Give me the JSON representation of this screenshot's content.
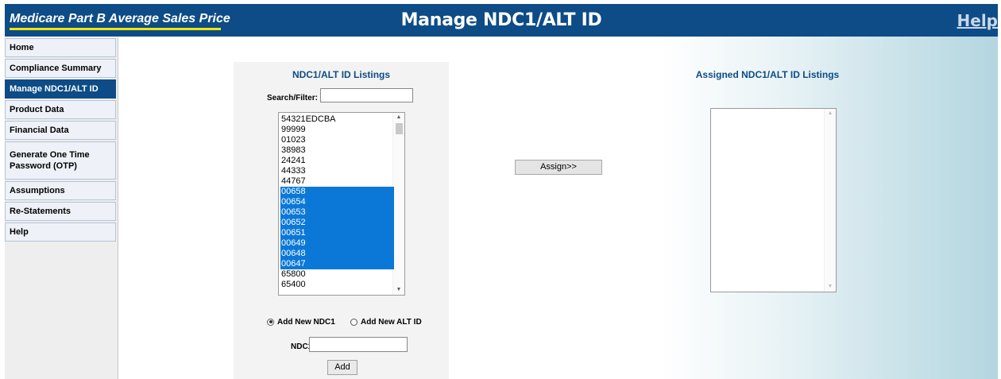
{
  "header": {
    "brand": "Medicare Part B Average Sales Price",
    "title": "Manage NDC1/ALT ID",
    "help_link": "Help",
    "color_header_bg": "#0d4c86",
    "color_brand_underline": "#f2e600"
  },
  "sidebar": {
    "items": [
      {
        "label": "Home",
        "active": false
      },
      {
        "label": "Compliance Summary",
        "active": false
      },
      {
        "label": "Manage NDC1/ALT ID",
        "active": true
      },
      {
        "label": "Product Data",
        "active": false
      },
      {
        "label": "Financial Data",
        "active": false
      },
      {
        "label": "Generate One Time Password (OTP)",
        "active": false
      },
      {
        "label": "Assumptions",
        "active": false
      },
      {
        "label": "Re-Statements",
        "active": false
      },
      {
        "label": "Help",
        "active": false
      }
    ]
  },
  "listings": {
    "title": "NDC1/ALT ID Listings",
    "search_label": "Search/Filter:",
    "search_value": "",
    "items": [
      {
        "label": "54321EDCBA",
        "selected": false
      },
      {
        "label": "99999",
        "selected": false
      },
      {
        "label": "01023",
        "selected": false
      },
      {
        "label": "38983",
        "selected": false
      },
      {
        "label": "24241",
        "selected": false
      },
      {
        "label": "44333",
        "selected": false
      },
      {
        "label": "44767",
        "selected": false
      },
      {
        "label": "00658",
        "selected": true
      },
      {
        "label": "00654",
        "selected": true
      },
      {
        "label": "00653",
        "selected": true
      },
      {
        "label": "00652",
        "selected": true
      },
      {
        "label": "00651",
        "selected": true
      },
      {
        "label": "00649",
        "selected": true
      },
      {
        "label": "00648",
        "selected": true
      },
      {
        "label": "00647",
        "selected": true
      },
      {
        "label": "65800",
        "selected": false
      },
      {
        "label": "65400",
        "selected": false
      }
    ],
    "radio_add_ndc1": "Add New NDC1",
    "radio_add_alt_id": "Add New ALT ID",
    "selected_radio": "Add New NDC1",
    "ndc1_label": "NDC1:",
    "ndc1_value": "",
    "add_button": "Add",
    "color_selection": "#0b78d7"
  },
  "assign_button": "Assign>>",
  "assigned": {
    "title": "Assigned NDC1/ALT ID Listings",
    "items": []
  }
}
